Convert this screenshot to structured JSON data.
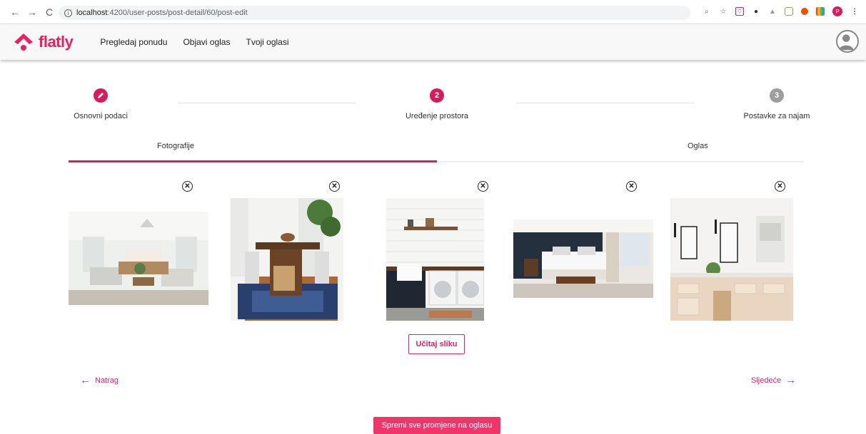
{
  "browser": {
    "url_host": "localhost",
    "url_path": ":4200/user-posts/post-detail/60/post-edit",
    "profile_initial": "P"
  },
  "header": {
    "logo_text": "flatly",
    "nav": [
      "Pregledaj ponudu",
      "Objavi oglas",
      "Tvoji oglasi"
    ]
  },
  "stepper": {
    "steps": [
      {
        "number": "",
        "label": "Osnovni podaci",
        "state": "edit"
      },
      {
        "number": "2",
        "label": "Uređenje prostora",
        "state": "active"
      },
      {
        "number": "3",
        "label": "Postavke za najam",
        "state": "pending"
      }
    ]
  },
  "tabs": {
    "items": [
      "Fotografije",
      "Oglas"
    ],
    "selected": 0
  },
  "photos": {
    "close_glyph": "✕",
    "items": [
      "living-room",
      "dining-room",
      "laundry-room",
      "bedroom",
      "bathroom"
    ]
  },
  "actions": {
    "upload_label": "Učitaj sliku",
    "back_label": "Natrag",
    "next_label": "Sljedeće",
    "save_label": "Spremi sve promjene na oglasu"
  },
  "colors": {
    "accent": "#e91e63",
    "save_button": "#f0356b",
    "pending_step": "#9e9e9e"
  }
}
